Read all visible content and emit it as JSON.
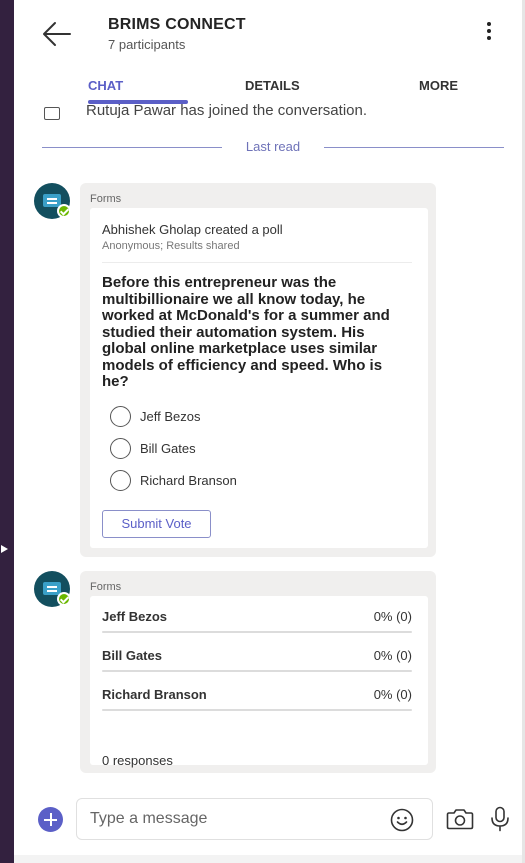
{
  "header": {
    "title": "BRIMS CONNECT",
    "subtitle": "7 participants",
    "back_icon": "arrow-left-icon",
    "menu_icon": "kebab-menu-icon"
  },
  "tabs": [
    {
      "label": "CHAT",
      "active": true
    },
    {
      "label": "DETAILS",
      "active": false
    },
    {
      "label": "MORE",
      "active": false
    }
  ],
  "system_message": "Rutuja Pawar has joined the conversation.",
  "divider_label": "Last read",
  "poll": {
    "source": "Forms",
    "author_line": "Abhishek Gholap created a poll",
    "meta": "Anonymous; Results shared",
    "question": "Before this entrepreneur was the multibillionaire we all know today, he worked at McDonald's for a summer and studied their automation system. His global online marketplace uses similar models of efficiency and speed. Who is he?",
    "options": [
      "Jeff Bezos",
      "Bill Gates",
      "Richard Branson"
    ],
    "submit_label": "Submit Vote"
  },
  "results": {
    "source": "Forms",
    "rows": [
      {
        "name": "Jeff Bezos",
        "percent_label": "0% (0)",
        "fraction": 0
      },
      {
        "name": "Bill Gates",
        "percent_label": "0% (0)",
        "fraction": 0
      },
      {
        "name": "Richard Branson",
        "percent_label": "0% (0)",
        "fraction": 0
      }
    ],
    "responses_label": "0 responses"
  },
  "composer": {
    "placeholder": "Type a message",
    "icons": [
      "add-icon",
      "emoji-icon",
      "camera-icon",
      "microphone-icon"
    ]
  },
  "colors": {
    "accent": "#5b5fc7",
    "bubble_bg": "#f0efee",
    "avatar_bg": "#134f5f",
    "presence_available": "#6bb700"
  }
}
